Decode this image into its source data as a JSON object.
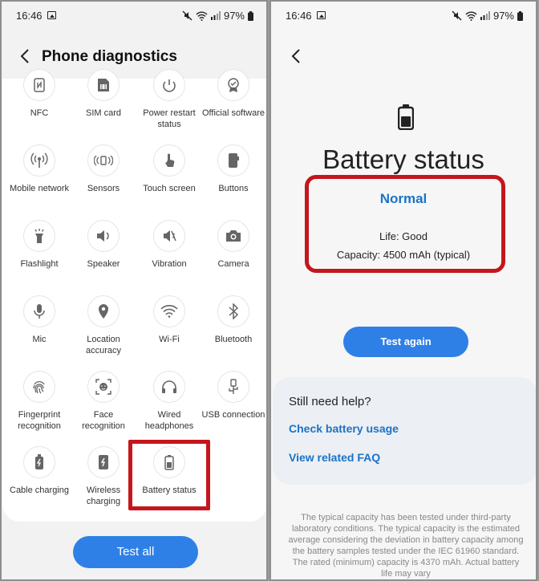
{
  "status_bar": {
    "time": "16:46",
    "battery": "97%"
  },
  "left": {
    "title": "Phone diagnostics",
    "items": [
      {
        "label": "NFC",
        "icon": "nfc-icon"
      },
      {
        "label": "SIM card",
        "icon": "sim-card-icon"
      },
      {
        "label": "Power restart status",
        "icon": "power-restart-icon"
      },
      {
        "label": "Official software",
        "icon": "official-software-icon"
      },
      {
        "label": "Mobile network",
        "icon": "mobile-network-icon"
      },
      {
        "label": "Sensors",
        "icon": "sensors-icon"
      },
      {
        "label": "Touch screen",
        "icon": "touch-screen-icon"
      },
      {
        "label": "Buttons",
        "icon": "buttons-icon"
      },
      {
        "label": "Flashlight",
        "icon": "flashlight-icon"
      },
      {
        "label": "Speaker",
        "icon": "speaker-icon"
      },
      {
        "label": "Vibration",
        "icon": "vibration-icon"
      },
      {
        "label": "Camera",
        "icon": "camera-icon"
      },
      {
        "label": "Mic",
        "icon": "mic-icon"
      },
      {
        "label": "Location accuracy",
        "icon": "location-icon"
      },
      {
        "label": "Wi-Fi",
        "icon": "wifi-icon"
      },
      {
        "label": "Bluetooth",
        "icon": "bluetooth-icon"
      },
      {
        "label": "Fingerprint recognition",
        "icon": "fingerprint-icon"
      },
      {
        "label": "Face recognition",
        "icon": "face-icon"
      },
      {
        "label": "Wired headphones",
        "icon": "headphones-icon"
      },
      {
        "label": "USB connection",
        "icon": "usb-icon"
      },
      {
        "label": "Cable charging",
        "icon": "cable-charging-icon"
      },
      {
        "label": "Wireless charging",
        "icon": "wireless-charging-icon"
      },
      {
        "label": "Battery status",
        "icon": "battery-icon"
      }
    ],
    "test_all_label": "Test all"
  },
  "right": {
    "title": "Battery status",
    "result": "Normal",
    "life": "Life: Good",
    "capacity": "Capacity: 4500 mAh (typical)",
    "test_again_label": "Test again",
    "help_title": "Still need help?",
    "link_usage": "Check battery usage",
    "link_faq": "View related FAQ",
    "footnote": "The typical capacity has been tested under third-party laboratory conditions. The typical capacity is the estimated average considering the deviation in battery capacity among the battery samples tested under the IEC 61960 standard. The rated (minimum) capacity is 4370 mAh. Actual battery life may vary"
  },
  "colors": {
    "accent": "#2f80e6",
    "link": "#1b73c8",
    "highlight": "#c4161c"
  }
}
